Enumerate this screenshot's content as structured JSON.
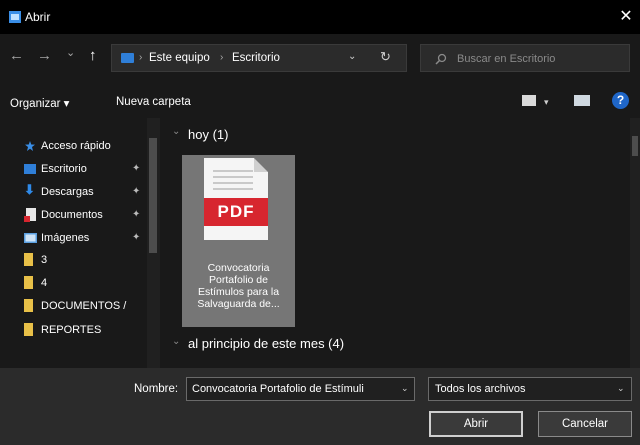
{
  "window": {
    "title": "Abrir",
    "close_glyph": "✕"
  },
  "nav": {
    "back_glyph": "←",
    "forward_glyph": "→",
    "recent_glyph": "⌄",
    "up_glyph": "↑",
    "breadcrumb": [
      "Este equipo",
      "Escritorio"
    ],
    "breadcrumb_sep": "›",
    "dropdown_glyph": "⌄",
    "refresh_glyph": "↻",
    "search_placeholder": "Buscar en Escritorio"
  },
  "toolbar": {
    "organize_label": "Organizar ▾",
    "new_folder_label": "Nueva carpeta",
    "view_dropdown_glyph": "▾",
    "help_glyph": "?"
  },
  "sidebar": {
    "items": [
      {
        "label": "Acceso rápido",
        "icon": "star-icon",
        "pinned": false
      },
      {
        "label": "Escritorio",
        "icon": "desktop-icon",
        "pinned": true
      },
      {
        "label": "Descargas",
        "icon": "download-icon",
        "pinned": true
      },
      {
        "label": "Documentos",
        "icon": "documents-icon",
        "pinned": true
      },
      {
        "label": "Imágenes",
        "icon": "pictures-icon",
        "pinned": true
      },
      {
        "label": "3",
        "icon": "folder-icon",
        "pinned": false
      },
      {
        "label": "4",
        "icon": "folder-icon",
        "pinned": false
      },
      {
        "label": "DOCUMENTOS /",
        "icon": "folder-icon",
        "pinned": false
      },
      {
        "label": "REPORTES",
        "icon": "folder-icon",
        "pinned": false
      }
    ],
    "pin_glyph": "📌"
  },
  "content": {
    "groups": [
      {
        "label": "hoy (1)"
      },
      {
        "label": "al principio de este mes (4)"
      }
    ],
    "group_chevron": "⌄",
    "file": {
      "badge": "PDF",
      "name_lines": [
        "Convocatoria",
        "Portafolio de",
        "Estímulos para la",
        "Salvaguarda de..."
      ]
    }
  },
  "footer": {
    "filename_label": "Nombre:",
    "filename_value": "Convocatoria Portafolio de Estímuli",
    "dropdown_glyph": "⌄",
    "filetype_value": "Todos los archivos",
    "open_label": "Abrir",
    "cancel_label": "Cancelar"
  },
  "colors": {
    "accent_blue": "#1f66c8",
    "pdf_red": "#d7262f",
    "folder_yellow": "#e8c048",
    "selection_gray": "#767676"
  }
}
